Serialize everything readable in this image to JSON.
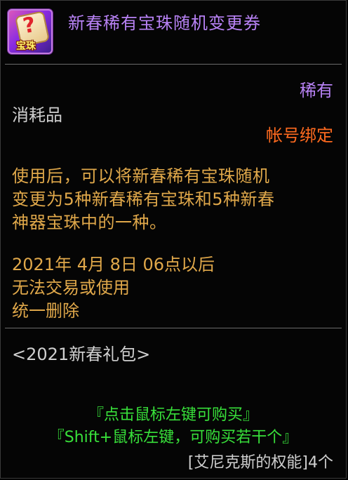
{
  "item": {
    "title": "新春稀有宝珠随机变更券",
    "icon_name": "scroll-question-icon",
    "icon_label": "宝珠",
    "rarity": "稀有",
    "category": "消耗品",
    "binding": "帐号绑定"
  },
  "description": [
    "使用后，可以将新春稀有宝珠随机",
    "变更为5种新春稀有宝珠和5种新春",
    "神器宝珠中的一种。"
  ],
  "expiry": [
    "2021年  4月  8日  06点以后",
    "无法交易或使用",
    "统一删除"
  ],
  "package": "<2021新春礼包>",
  "actions": {
    "buy_click": "『点击鼠标左键可购买』",
    "buy_shift": "『Shift+鼠标左键，可购买若干个』"
  },
  "requirement": "[艾尼克斯的权能]4个",
  "colors": {
    "title": "#b882f5",
    "rarity": "#b882f5",
    "binding": "#ff6a1f",
    "description": "#e0a84a",
    "action": "#38e03a",
    "neutral": "#cfcfcf"
  }
}
